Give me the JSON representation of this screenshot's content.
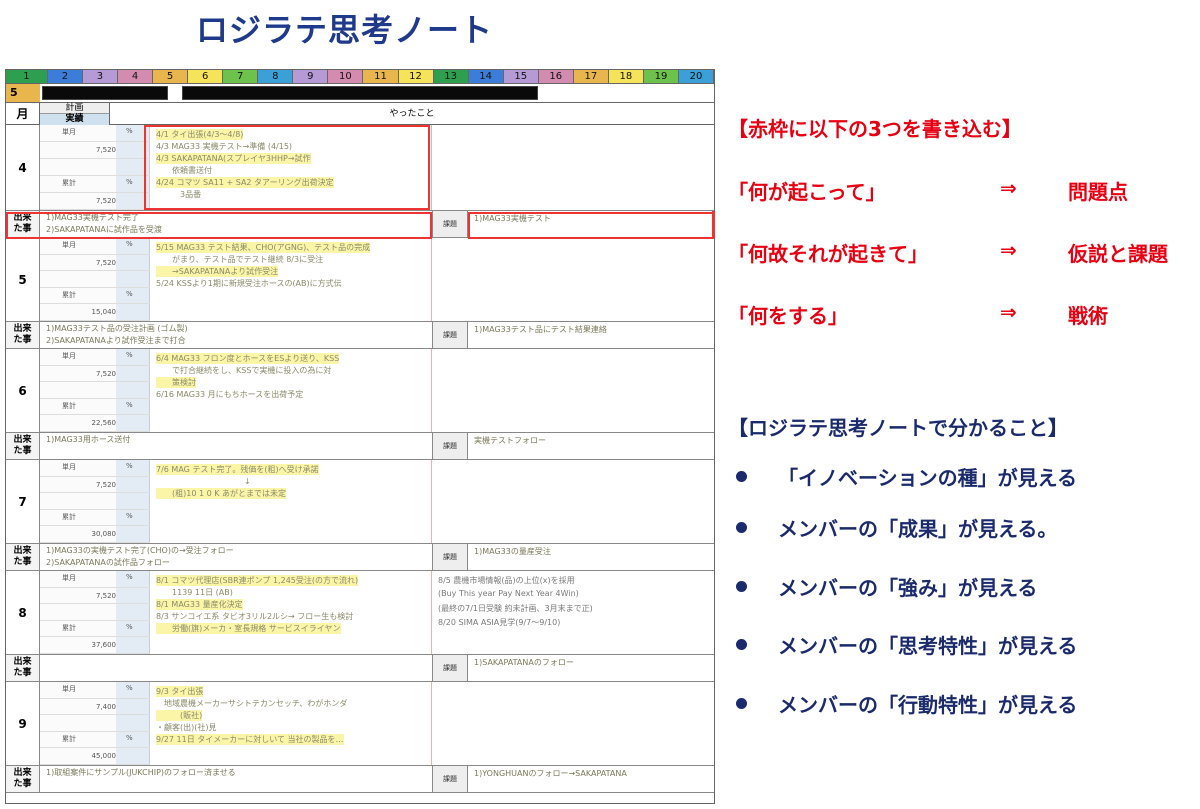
{
  "title": "ロジラテ思考ノート",
  "sheet": {
    "ruler": [
      "1",
      "2",
      "3",
      "4",
      "5",
      "6",
      "7",
      "8",
      "9",
      "10",
      "11",
      "12",
      "13",
      "14",
      "15",
      "16",
      "17",
      "18",
      "19",
      "20"
    ],
    "ruler_colors": [
      "#2e9e4f",
      "#3b7dd8",
      "#b59ad6",
      "#d48bb0",
      "#e8b64c",
      "#f5e35a",
      "#6cc24a",
      "#3b9fd8",
      "#b59ad6",
      "#d48bb0",
      "#e8b64c",
      "#f5e35a",
      "#2e9e4f",
      "#3b7dd8",
      "#b59ad6",
      "#d48bb0",
      "#e8b64c",
      "#f5e35a",
      "#6cc24a",
      "#3b9fd8"
    ],
    "row2_month": "5",
    "header": {
      "month": "月",
      "plan": "計画",
      "actual": "実績",
      "done": "やったこと"
    },
    "stat_labels": {
      "monthly": "単月",
      "cumulative": "累計",
      "pct": "%"
    },
    "event_label": "出来た事",
    "issue_label": "課題",
    "months": [
      {
        "m": "4",
        "v1": "7,520",
        "v2": "7,520",
        "notes": [
          "4/1 タイ出張(4/3〜4/8)",
          "4/3 MAG33 実機テスト→準備 (4/15)",
          "4/3 SAKAPATANA(スプレイヤ3HHP→試作",
          "　　依頼書送付",
          "4/24 コマツ SA11 + SA2 タアーリング出荷決定",
          "　　　3品番"
        ],
        "ev1": "1)MAG33実機テスト完了",
        "ev1b": "2)SAKAPATANAに試作品を受渡",
        "ev2": "1)MAG33実機テスト",
        "issue": true
      },
      {
        "m": "5",
        "v1": "7,520",
        "v2": "15,040",
        "notes": [
          "5/15 MAG33 テスト結果、CHO(アGNG)、テスト品の完成",
          "　　がまり、テスト品でテスト継続 8/3に受注",
          "　　→SAKAPATANAより試作受注",
          "5/24 KSSより1期に新規受注ホースの(AB)に方式伝"
        ],
        "ev1": "1)MAG33テスト品の受注計画 (ゴム製)",
        "ev1b": "2)SAKAPATANAより試作受注まで打合",
        "ev2": "1)MAG33テスト品にテスト結果連絡",
        "issue": true
      },
      {
        "m": "6",
        "v1": "7,520",
        "v2": "22,560",
        "notes": [
          "6/4 MAG33 フロン度とホースをESより送り、KSS",
          "　　で打合継続をし、KSSで実機に投入の為に対",
          "　　策検討",
          "6/16 MAG33 月にもちホースを出荷予定"
        ],
        "ev1": "1)MAG33用ホース送付",
        "ev1b": "",
        "ev2": "実機テストフォロー",
        "issue": true
      },
      {
        "m": "7",
        "v1": "7,520",
        "v2": "30,080",
        "notes": [
          "7/6 MAG テスト完了。残価を(粗)へ受け承諾",
          "　　　　　　　　　　　↓",
          "　　(粗)10 1 0 K あがとまでは未定"
        ],
        "ev1": "1)MAG33の実機テスト完了(CHO)の→受注フォロー",
        "ev1b": "2)SAKAPATANAの試作品フォロー",
        "ev2": "1)MAG33の量産受注",
        "issue": true
      },
      {
        "m": "8",
        "v1": "7,520",
        "v2": "37,600",
        "notes": [
          "8/1 コマツ代理店(SBR連ポンプ 1,245受注(の方で流れ)",
          "　　1139 11日 (AB)",
          "8/1 MAG33 量産化決定",
          "8/3 サンコイエ系 タビオ3リル2ルシ→ フロー生も検討",
          "　　労働(旗)メーカ・室長規格 サービスイライヤン"
        ],
        "ev1": "",
        "ev1b": "",
        "ev2": "1)SAKAPATANAのフォロー",
        "issue": true
      },
      {
        "m": "9",
        "v1": "7,400",
        "v2": "45,000",
        "notes": [
          "9/3 タイ出張",
          "　地域農機メーカーサシトテカンセッチ、わがホンダ",
          "　　　(販社)",
          "・顧客(出)(社)見",
          "9/27 11日 タイメーカーに対しいて 当社の製品を…"
        ],
        "ev1": "1)取組案件にサンプル(JUKCHIP)のフォロー済ませる",
        "ev1b": "",
        "ev2": "1)YONGHUANのフォロー→SAKAPATANA",
        "issue": true
      }
    ],
    "month8_right": [
      "8/5 農機市場情報(品)の上位(x)を採用",
      "(Buy This year  Pay Next Year 4Win)",
      "(最終の7/1日受験 約未計画、3月末まで正)",
      "8/20 SIMA ASIA見学(9/7〜9/10)"
    ]
  },
  "right": {
    "instruction_title": "【赤枠に以下の3つを書き込む】",
    "mappings": [
      {
        "left": "「何が起こって」",
        "arrow": "⇒",
        "right": "問題点"
      },
      {
        "left": "「何故それが起きて」",
        "arrow": "⇒",
        "right": "仮説と課題"
      },
      {
        "left": "「何をする」",
        "arrow": "⇒",
        "right": "戦術"
      }
    ],
    "benefits_title": "【ロジラテ思考ノートで分かること】",
    "benefits": [
      "「イノベーションの種」が見える",
      "メンバーの「成果」が見える。",
      "メンバーの「強み」が見える",
      "メンバーの「思考特性」が見える",
      "メンバーの「行動特性」が見える"
    ],
    "red_color": "#e60012",
    "navy_color": "#1a2a6c"
  }
}
